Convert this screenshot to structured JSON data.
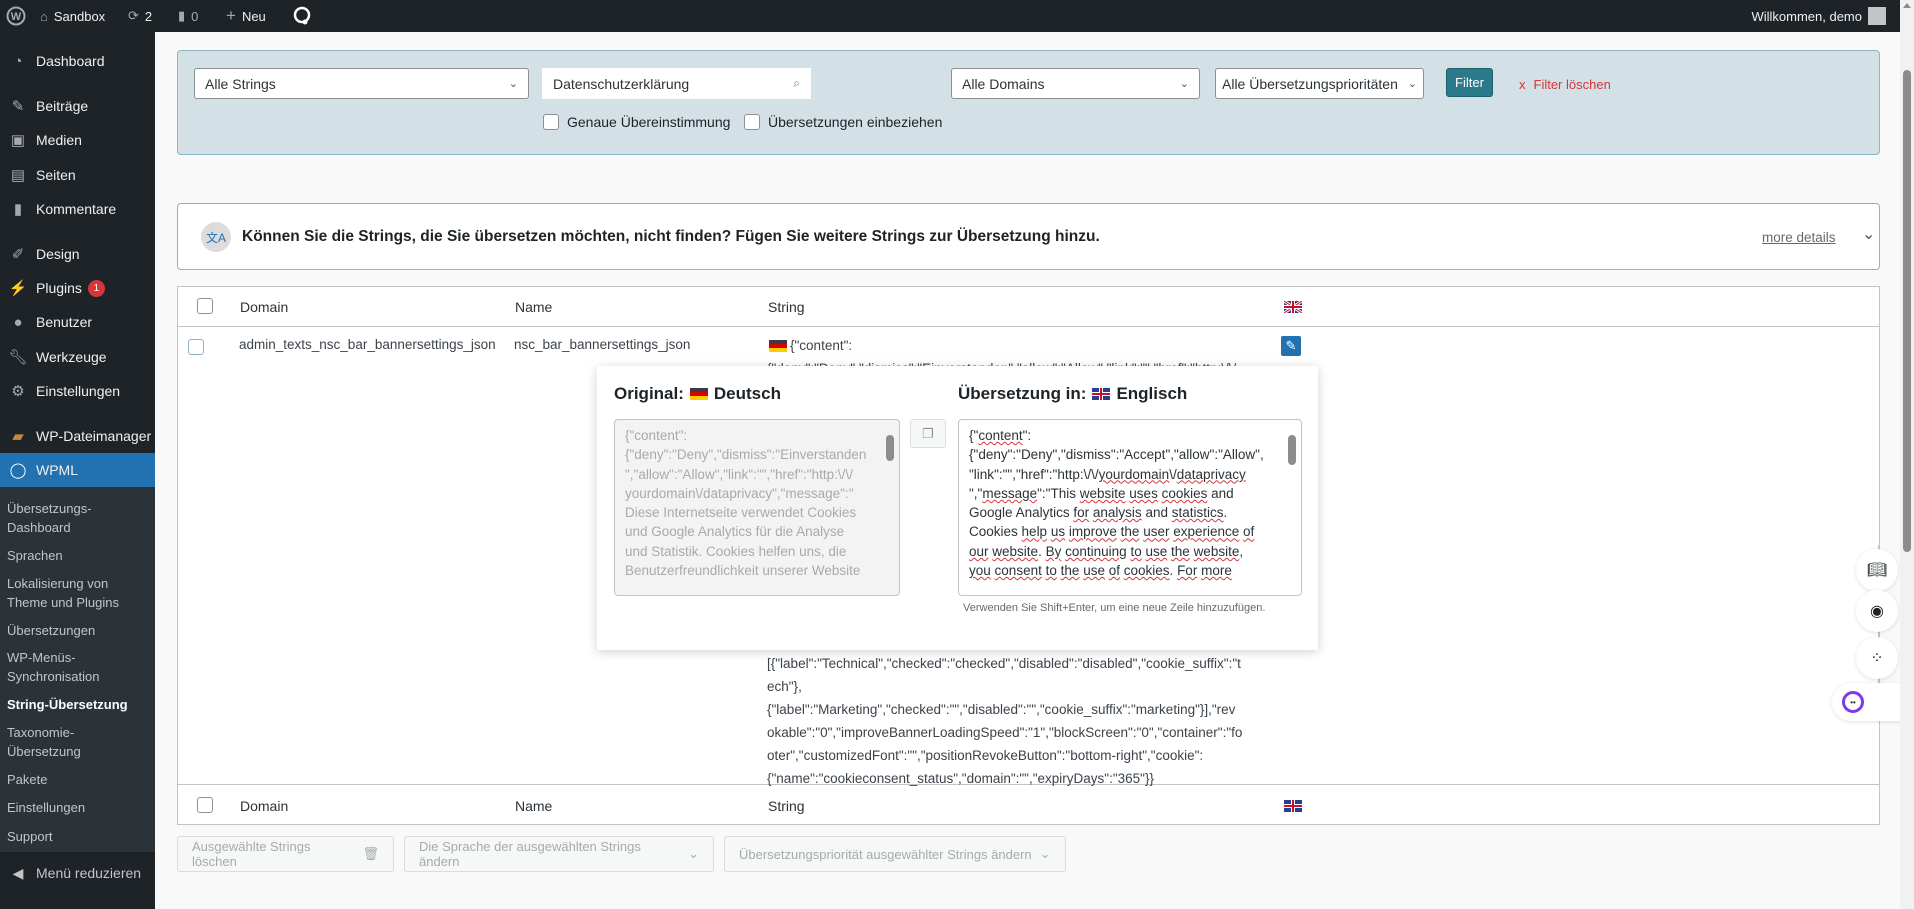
{
  "adminbar": {
    "site": "Sandbox",
    "updates": "2",
    "comments": "0",
    "new": "Neu",
    "welcome": "Willkommen, demo"
  },
  "sidebar": {
    "items": [
      {
        "label": "Dashboard",
        "icon": "dashboard-icon"
      },
      {
        "label": "Beiträge",
        "icon": "pin-icon"
      },
      {
        "label": "Medien",
        "icon": "media-icon"
      },
      {
        "label": "Seiten",
        "icon": "pages-icon"
      },
      {
        "label": "Kommentare",
        "icon": "comment-icon"
      },
      {
        "label": "Design",
        "icon": "brush-icon"
      },
      {
        "label": "Plugins",
        "icon": "plugin-icon",
        "badge": "1"
      },
      {
        "label": "Benutzer",
        "icon": "user-icon"
      },
      {
        "label": "Werkzeuge",
        "icon": "wrench-icon"
      },
      {
        "label": "Einstellungen",
        "icon": "settings-icon"
      },
      {
        "label": "WP-Dateimanager",
        "icon": "folder-icon"
      },
      {
        "label": "WPML",
        "icon": "wpml-icon"
      }
    ],
    "submenu": [
      "Übersetzungs-\nDashboard",
      "Sprachen",
      "Lokalisierung von\nTheme und Plugins",
      "Übersetzungen",
      "WP-Menüs-\nSynchronisation",
      "String-Übersetzung",
      "Taxonomie-\nÜbersetzung",
      "Pakete",
      "Einstellungen",
      "Support"
    ],
    "collapse": "Menü reduzieren"
  },
  "filter": {
    "strings_select": "Alle Strings",
    "search_value": "Datenschutzerklärung",
    "domains_select": "Alle Domains",
    "priority_select": "Alle Übersetzungsprioritäten",
    "filter_button": "Filter",
    "clear": "Filter löschen",
    "clear_x": "x",
    "exact_match": "Genaue Übereinstimmung",
    "include_translations": "Übersetzungen einbeziehen"
  },
  "notice": {
    "text": "Können Sie die Strings, die Sie übersetzen möchten, nicht finden? Fügen Sie weitere Strings zur Übersetzung hinzu.",
    "more": "more details"
  },
  "table": {
    "headers": {
      "domain": "Domain",
      "name": "Name",
      "string": "String"
    },
    "row": {
      "domain": "admin_texts_nsc_bar_bannersettings_json",
      "name": "nsc_bar_bannersettings_json",
      "string_lines_top": [
        "{\"content\":",
        "{\"deny\":\"Deny\",\"dismiss\":\"Einverstanden\",\"allow\":\"Allow\",\"link\":\"\",\"href\":\"http:\\/\\/"
      ],
      "string_lines_bottom": [
        "[{\"label\":\"Technical\",\"checked\":\"checked\",\"disabled\":\"disabled\",\"cookie_suffix\":\"t",
        "ech\"},",
        "{\"label\":\"Marketing\",\"checked\":\"\",\"disabled\":\"\",\"cookie_suffix\":\"marketing\"}],\"rev",
        "okable\":\"0\",\"improveBannerLoadingSpeed\":\"1\",\"blockScreen\":\"0\",\"container\":\"fo",
        "oter\",\"customizedFont\":\"\",\"positionRevokeButton\":\"bottom-right\",\"cookie\":",
        "{\"name\":\"cookieconsent_status\",\"domain\":\"\",\"expiryDays\":\"365\"}}"
      ]
    }
  },
  "popup": {
    "original_label": "Original:",
    "original_lang": "Deutsch",
    "translation_label": "Übersetzung in:",
    "translation_lang": "Englisch",
    "original_text": "{\"content\":\n{\"deny\":\"Deny\",\"dismiss\":\"Einverstanden\n\",\"allow\":\"Allow\",\"link\":\"\",\"href\":\"http:\\/\\/\nyourdomain\\/dataprivacy\",\"message\":\"\nDiese Internetseite verwendet Cookies\nund Google Analytics für die Analyse\nund Statistik. Cookies helfen uns, die\nBenutzerfreundlichkeit unserer Website",
    "translation_text": "{\"content\":\n{\"deny\":\"Deny\",\"dismiss\":\"Accept\",\"allow\":\"Allow\",\n\"link\":\"\",\"href\":\"http:\\/\\/yourdomain\\/dataprivacy\n\",\"message\":\"This website uses cookies and\nGoogle Analytics for analysis and statistics.\nCookies help us improve the user experience of\nour website. By continuing to use the website,\nyou consent to the use of cookies. For more",
    "hint": "Verwenden Sie Shift+Enter, um eine neue Zeile hinzuzufügen."
  },
  "bulk": {
    "delete": "Ausgewählte Strings löschen",
    "language": "Die Sprache der ausgewählten Strings ändern",
    "priority": "Übersetzungspriorität ausgewählter Strings ändern"
  },
  "colors": {
    "accent": "#2271b1",
    "filter_bg": "#d3e1e6",
    "filter_button": "#2b7a8c",
    "clear": "#d63638"
  }
}
